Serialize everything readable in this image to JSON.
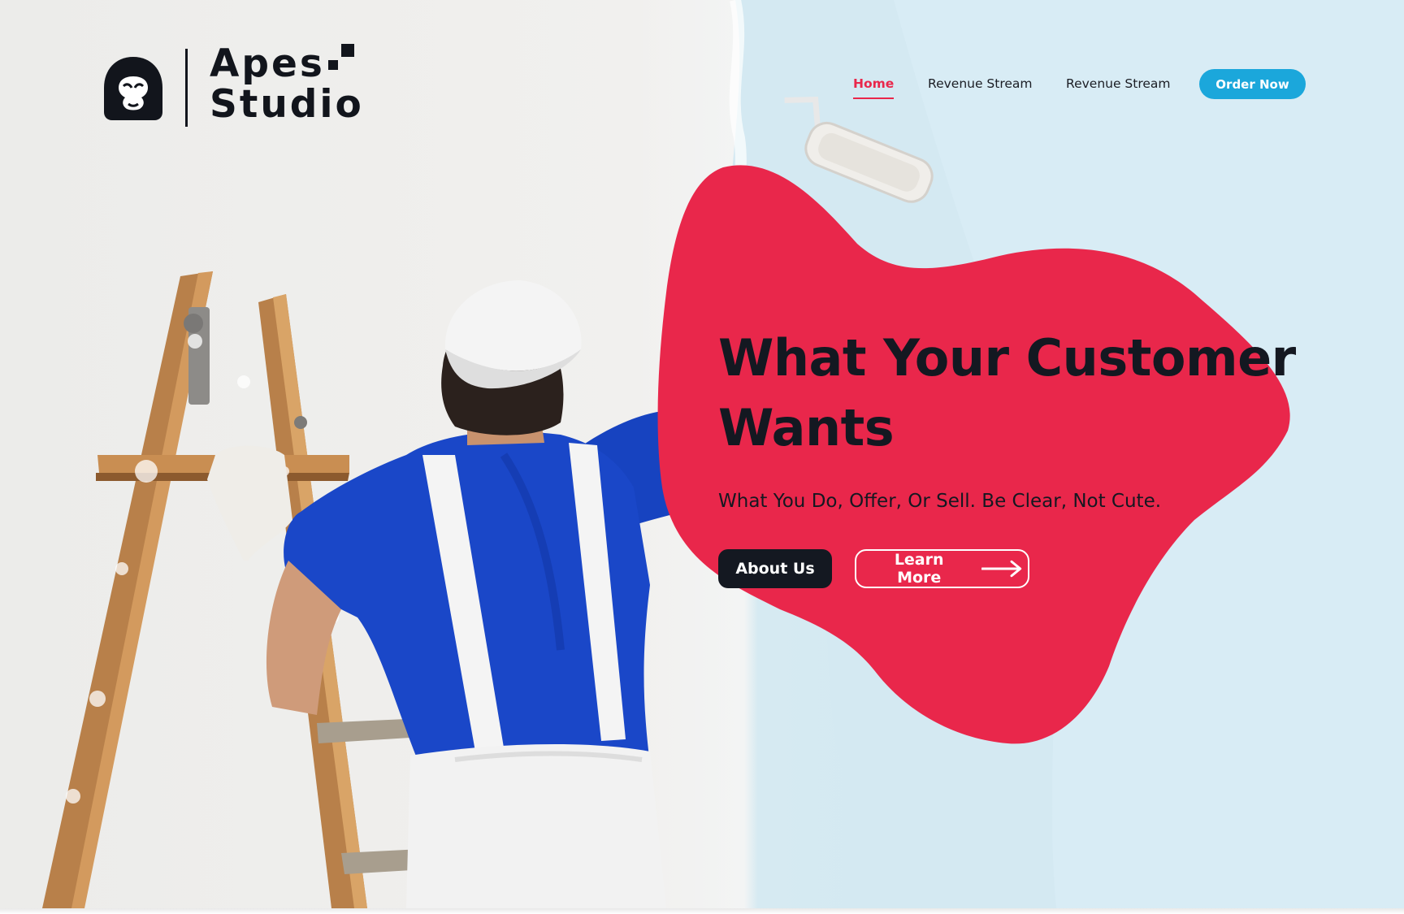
{
  "brand": {
    "name_line1": "Apes",
    "name_line2": "Studio",
    "logo_icon": "ape-head-icon"
  },
  "nav": {
    "items": [
      {
        "label": "Home",
        "active": true
      },
      {
        "label": "Revenue Stream",
        "active": false
      },
      {
        "label": "Revenue Stream",
        "active": false
      }
    ],
    "cta_label": "Order Now"
  },
  "hero": {
    "headline": "What Your Customer Wants",
    "subline": "What You Do, Offer, Or Sell. Be Clear, Not Cute.",
    "primary_button": "About  Us",
    "secondary_button": "Learn More",
    "secondary_icon": "arrow-right-icon",
    "image": "painter-on-ladder-photo"
  },
  "colors": {
    "accent_red": "#e9274b",
    "dark": "#141821",
    "cta_blue": "#1ba7db",
    "paint_blue": "#d2e8f2"
  }
}
